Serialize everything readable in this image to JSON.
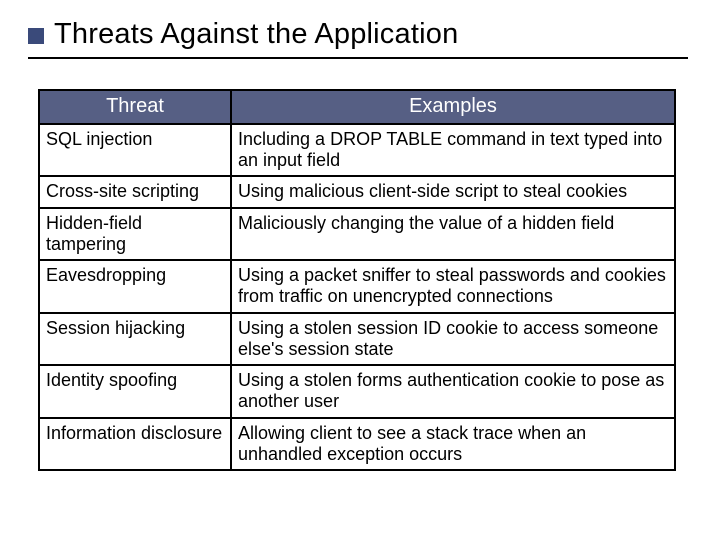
{
  "title": "Threats Against the Application",
  "table": {
    "headers": {
      "threat": "Threat",
      "examples": "Examples"
    },
    "rows": [
      {
        "threat": "SQL injection",
        "example": "Including a DROP TABLE command in text typed into an input field"
      },
      {
        "threat": "Cross-site scripting",
        "example": "Using malicious client-side script to steal cookies"
      },
      {
        "threat": "Hidden-field tampering",
        "example": "Maliciously changing the value of a hidden field"
      },
      {
        "threat": "Eavesdropping",
        "example": "Using a packet sniffer to steal passwords and cookies from traffic on unencrypted connections"
      },
      {
        "threat": "Session hijacking",
        "example": "Using a stolen session ID cookie to access someone else's session state"
      },
      {
        "threat": "Identity spoofing",
        "example": "Using a stolen forms authentication cookie to pose as another user"
      },
      {
        "threat": "Information disclosure",
        "example": "Allowing client to see a stack trace when an unhandled exception occurs"
      }
    ]
  }
}
